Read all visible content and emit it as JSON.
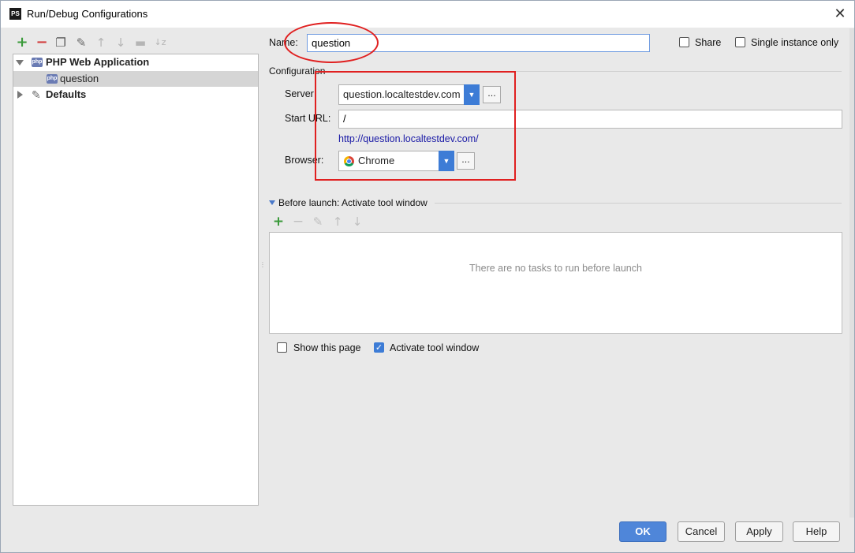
{
  "window": {
    "title": "Run/Debug Configurations",
    "app_icon": "PS"
  },
  "toolbar": {
    "add": "+",
    "remove": "−",
    "copy": "❐",
    "edit_defaults": "✎",
    "up": "↑",
    "down": "↓",
    "folder": "▬",
    "sort": "↓z"
  },
  "tree": {
    "group_label": "PHP Web Application",
    "item_label": "question",
    "defaults_label": "Defaults",
    "php_badge": "php"
  },
  "form": {
    "name_label": "Name:",
    "name_value": "question",
    "share_label": "Share",
    "share_checked": false,
    "single_instance_label": "Single instance only",
    "single_instance_checked": false,
    "configuration_title": "Configuration",
    "server_label": "Server",
    "server_value": "question.localtestdev.com",
    "start_url_label": "Start URL:",
    "start_url_value": "/",
    "resolved_url": "http://question.localtestdev.com/",
    "browser_label": "Browser:",
    "browser_value": "Chrome",
    "dots": "..."
  },
  "before_launch": {
    "title": "Before launch: Activate tool window",
    "empty_text": "There are no tasks to run before launch",
    "show_page_label": "Show this page",
    "show_page_checked": false,
    "activate_label": "Activate tool window",
    "activate_checked": true
  },
  "buttons": {
    "ok": "OK",
    "cancel": "Cancel",
    "apply": "Apply",
    "help": "Help"
  },
  "colors": {
    "accent": "#3d7cd6",
    "annotation": "#e02020",
    "link": "#1a1aa6",
    "add_green": "#3a9a3a",
    "remove_red": "#d23c3c"
  }
}
